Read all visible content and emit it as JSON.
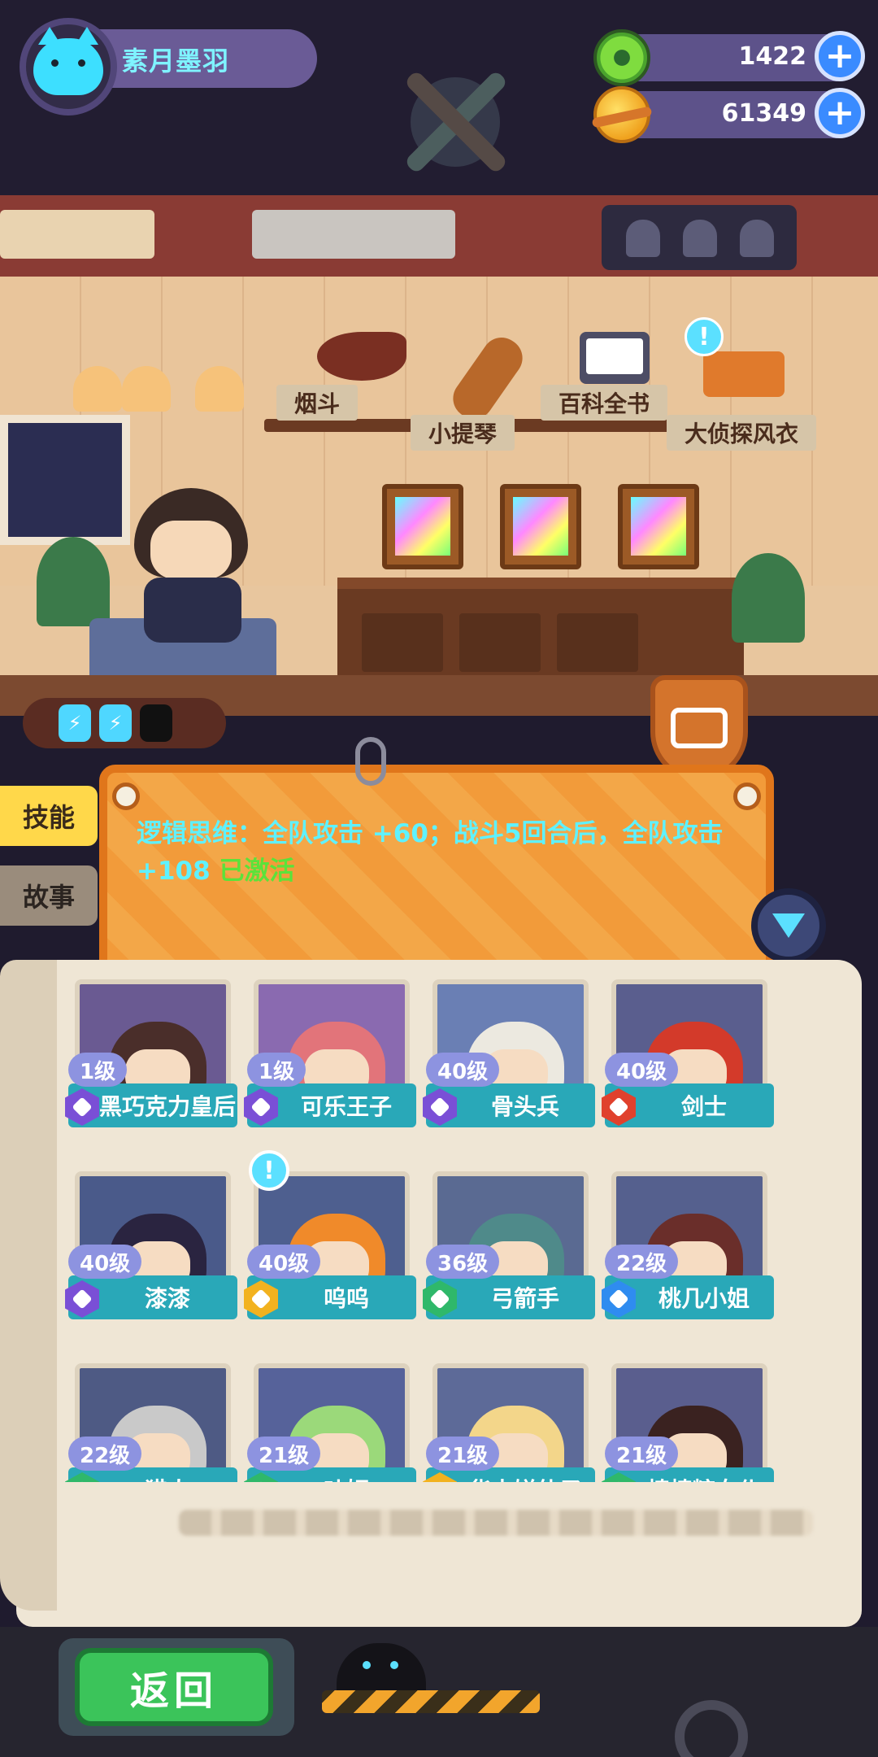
{
  "player": {
    "name": "素月墨羽"
  },
  "currencies": [
    {
      "icon": "green-donut-coin-icon",
      "value": "1422"
    },
    {
      "icon": "planet-coin-icon",
      "value": "61349"
    }
  ],
  "scene": {
    "shelf_labels": [
      "烟斗",
      "小提琴",
      "百科全书",
      "大侦探风衣"
    ]
  },
  "side_tabs": {
    "skill": "技能",
    "story": "故事"
  },
  "skill_info": {
    "text": "逻辑思维：全队攻击 +60；战斗5回合后，全队攻击 +108",
    "status": "已激活"
  },
  "characters": [
    {
      "level": "1级",
      "name": "黑巧克力皇后",
      "rarity": "purple",
      "bg": "#6a5a92",
      "hair": "#4a2e2a"
    },
    {
      "level": "1级",
      "name": "可乐王子",
      "rarity": "purple",
      "bg": "#8a6ab0",
      "hair": "#e2747a"
    },
    {
      "level": "40级",
      "name": "骨头兵",
      "rarity": "purple",
      "bg": "#6a7fb4",
      "hair": "#ece9e0"
    },
    {
      "level": "40级",
      "name": "剑士",
      "rarity": "red",
      "bg": "#5a5e8e",
      "hair": "#d33a2a"
    },
    {
      "level": "40级",
      "name": "漆漆",
      "rarity": "purple",
      "bg": "#4a5a8a",
      "hair": "#2a2440"
    },
    {
      "level": "40级",
      "name": "呜呜",
      "rarity": "gold",
      "bg": "#4e5f8f",
      "hair": "#f08a2a",
      "alert": "!"
    },
    {
      "level": "36级",
      "name": "弓箭手",
      "rarity": "green",
      "bg": "#5a6a92",
      "hair": "#4f8a8a"
    },
    {
      "level": "22级",
      "name": "桃几小姐",
      "rarity": "blue",
      "bg": "#55608e",
      "hair": "#6a2e2a"
    },
    {
      "level": "22级",
      "name": "猎人",
      "rarity": "green",
      "bg": "#4e5a84",
      "hair": "#c9c9c9"
    },
    {
      "level": "21级",
      "name": "叶姬",
      "rarity": "green",
      "bg": "#56629a",
      "hair": "#9bd97a"
    },
    {
      "level": "21级",
      "name": "华夫饼仙子",
      "rarity": "gold",
      "bg": "#5d6a98",
      "hair": "#f3d68a"
    },
    {
      "level": "21级",
      "name": "棒棒糖女仆",
      "rarity": "green",
      "bg": "#5a5e8e",
      "hair": "#3a2220"
    }
  ],
  "rarity_colors": {
    "purple": "#7a4fd6",
    "red": "#e0412d",
    "gold": "#f2b21f",
    "green": "#2fb86a",
    "blue": "#2f8cf0"
  },
  "energy": {
    "filled": 2,
    "total": 3
  },
  "back_button": "返回"
}
